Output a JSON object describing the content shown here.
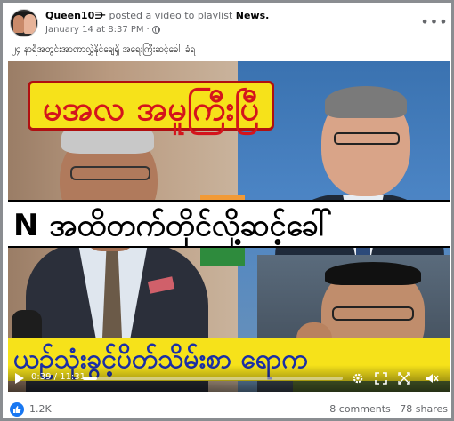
{
  "post": {
    "author": "Queen10",
    "author_badge": "⋺",
    "action_text": " posted a video to playlist ",
    "playlist": "News.",
    "timestamp": "January 14 at 8:37 PM",
    "separator": "·",
    "more_label": "•••",
    "caption": "၂၄ နာရီအတွင်းအာဏာလွှဲနိုင်ချေရှိ အရေးကြီးဆင့်ခေါ် ခံရ"
  },
  "video": {
    "headline_top": "မအလ အမူကြီးပြီ",
    "headline_middle": "N အထိတက်တိုင်လို့ဆင့်ခေါ်",
    "headline_bottom": "ယဉ်သုံးခွင့်ပိတ်သိမ်းစာ ရောက",
    "time_current": "0:39",
    "time_total": "11:31",
    "time_sep": " / ",
    "progress": 0.056,
    "icons": [
      "play-icon",
      "settings-icon",
      "fullscreen-icon",
      "expand-icon",
      "volume-icon"
    ]
  },
  "footer": {
    "reactions": "1.2K",
    "comments": "8 comments",
    "shares": "78 shares"
  },
  "colors": {
    "accent": "#1877f2",
    "headline_yellow": "#f6e21a",
    "headline_red": "#d4141c",
    "headline_blue": "#1b2fa6"
  }
}
